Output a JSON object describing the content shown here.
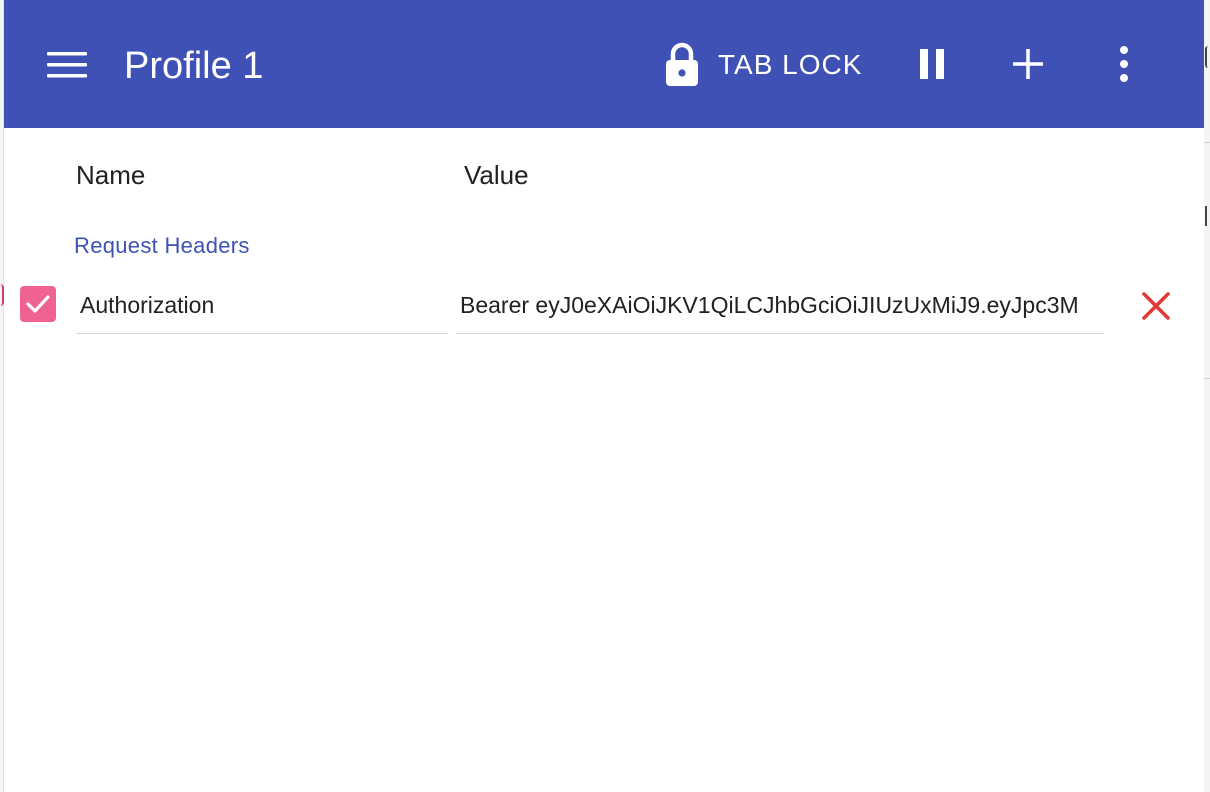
{
  "app": {
    "title": "Profile 1"
  },
  "toolbar": {
    "menu_icon": "hamburger-menu-icon",
    "lock_icon": "lock-icon",
    "tab_lock_label": "TAB LOCK",
    "pause_icon": "pause-icon",
    "add_icon": "plus-icon",
    "more_icon": "more-vert-icon"
  },
  "columns": {
    "name": "Name",
    "value": "Value"
  },
  "sections": [
    {
      "title": "Request Headers",
      "rows": [
        {
          "enabled": true,
          "name": "Authorization",
          "value": "Bearer eyJ0eXAiOiJKV1QiLCJhbGciOiJIUzUxMiJ9.eyJpc3M"
        }
      ]
    }
  ],
  "colors": {
    "primary": "#3f51b5",
    "checkbox": "#f06292",
    "delete": "#e53935"
  }
}
